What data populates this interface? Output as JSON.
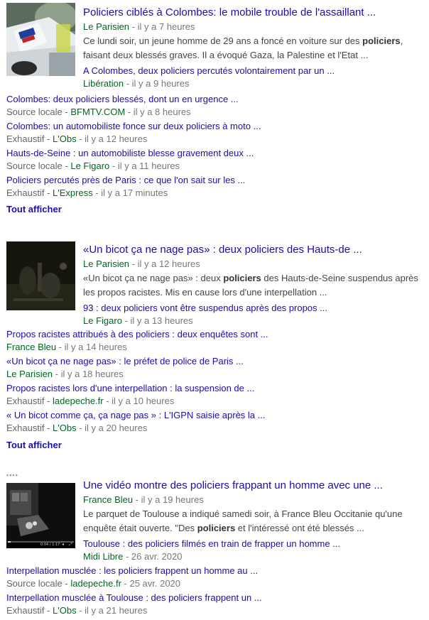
{
  "clusters": [
    {
      "title": "Policiers ciblés à Colombes: le mobile trouble de l'assaillant ...",
      "source": "Le Parisien",
      "age": " - il y a 7 heures",
      "snippet_pre": "Ce lundi soir, un jeune homme de 29 ans a foncé en voiture sur des ",
      "snippet_bold": "policiers",
      "snippet_post": ", faisant deux blessés graves. Il a évoqué Gaza, la Palestine et l'Etat ...",
      "sub_title": "A Colombes, deux policiers percutés volontairement par un ...",
      "sub_source": "Libération",
      "sub_age": " - il y a 9 heures",
      "related": [
        {
          "title": "Colombes: deux policiers blessés, dont un en urgence ...",
          "label": "Source locale",
          "sep": " - ",
          "source": "BFMTV.COM",
          "age": " - il y a 8 heures"
        },
        {
          "title": "Colombes: un automobiliste fonce sur deux policiers à moto ...",
          "label": "Exhaustif",
          "sep": " - ",
          "source": "L'Obs",
          "age": " - il y a 12 heures"
        },
        {
          "title": "Hauts-de-Seine : un automobiliste blesse gravement deux ...",
          "label": "Source locale",
          "sep": " - ",
          "source": "Le Figaro",
          "age": " - il y a 11 heures"
        },
        {
          "title": "Policiers percutés près de Paris : ce que l'on sait sur les ...",
          "label": "Exhaustif",
          "sep": " - ",
          "source": "L'Express",
          "age": " - il y a 17 minutes"
        }
      ],
      "show_all": "Tout afficher"
    },
    {
      "title": "«Un bicot ça ne nage pas» : deux policiers des Hauts-de ...",
      "source": "Le Parisien",
      "age": " - il y a 12 heures",
      "snippet_pre": "«Un bicot ça ne nage pas» : deux ",
      "snippet_bold": "policiers",
      "snippet_post": " des Hauts-de-Seine suspendus après les propos racistes. Mis en cause lors d'une interpellation ...",
      "sub_title": "93 : deux policiers vont être suspendus après des propos ...",
      "sub_source": "Le Figaro",
      "sub_age": " - il y a 13 heures",
      "related": [
        {
          "title": "Propos racistes attribués à des policiers : deux enquêtes sont ...",
          "label": "",
          "sep": "",
          "source": "France Bleu",
          "age": " - il y a 14 heures"
        },
        {
          "title": "«Un bicot ça ne nage pas» : le préfet de police de Paris ...",
          "label": "",
          "sep": "",
          "source": "Le Parisien",
          "age": " - il y a 18 heures"
        },
        {
          "title": "Propos racistes lors d'une interpellation : la suspension de ...",
          "label": "Exhaustif",
          "sep": " - ",
          "source": "ladepeche.fr",
          "age": " - il y a 10 heures"
        },
        {
          "title": "« Un bicot comme ça, ça nage pas » : L'IGPN saisie après la ...",
          "label": "Exhaustif",
          "sep": " - ",
          "source": "L'Obs",
          "age": " - il y a 20 heures"
        }
      ],
      "show_all": "Tout afficher"
    },
    {
      "title": "Une vidéo montre des policiers frappant un homme avec une ...",
      "source": "France Bleu",
      "age": " - il y a 19 heures",
      "snippet_pre": "Le parquet de Toulouse a indiqué samedi soir, à France Bleu Occitanie qu'une enquête était ouverte. \"Des ",
      "snippet_bold": "policiers",
      "snippet_post": " et l'intéressé ont été blessés ...",
      "sub_title": "Toulouse : des policiers filmés en train de frapper un homme ...",
      "sub_source": "Midi Libre",
      "sub_age": " - 26 avr. 2020",
      "video_time": "0:04 / 1:17",
      "related": [
        {
          "title": "Interpellation musclée : les policiers frappent un homme au ...",
          "label": "Source locale",
          "sep": " - ",
          "source": "ladepeche.fr",
          "age": " - 25 avr. 2020"
        },
        {
          "title": "Interpellation musclée à Toulouse : des policiers frappent un ...",
          "label": "Exhaustif",
          "sep": " - ",
          "source": "L'Obs",
          "age": " - il y a 21 heures"
        }
      ]
    }
  ]
}
